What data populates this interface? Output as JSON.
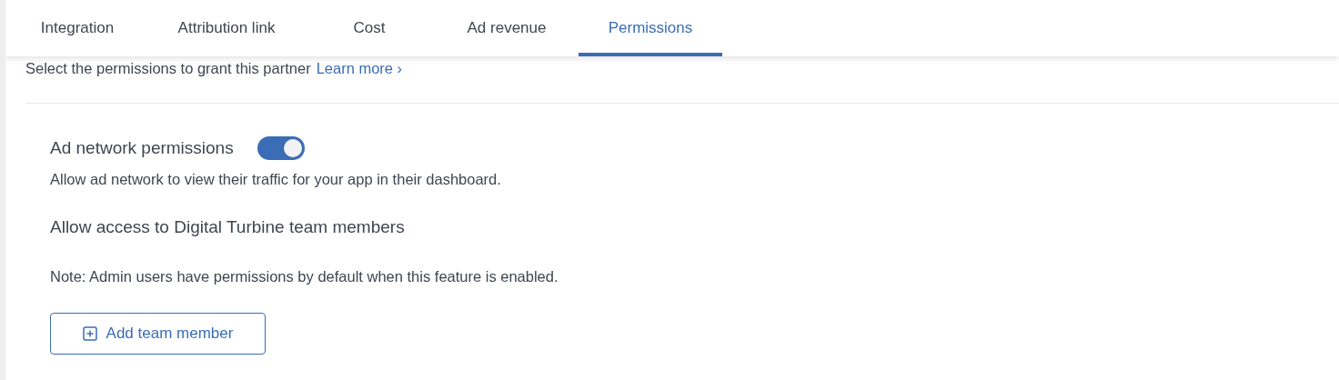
{
  "tabs": [
    {
      "label": "Integration",
      "selected": false
    },
    {
      "label": "Attribution link",
      "selected": false
    },
    {
      "label": "Cost",
      "selected": false
    },
    {
      "label": "Ad revenue",
      "selected": false
    },
    {
      "label": "Permissions",
      "selected": true
    }
  ],
  "intro": {
    "text": "Select the permissions to grant this partner",
    "link": "Learn more ›"
  },
  "ad_network": {
    "label": "Ad network permissions",
    "on": true,
    "description": "Allow ad network to view their traffic for your app in their dashboard."
  },
  "team_access": {
    "heading": "Allow access to Digital Turbine team members",
    "note": "Note: Admin users have permissions by default when this feature is enabled.",
    "button": "Add team member"
  }
}
